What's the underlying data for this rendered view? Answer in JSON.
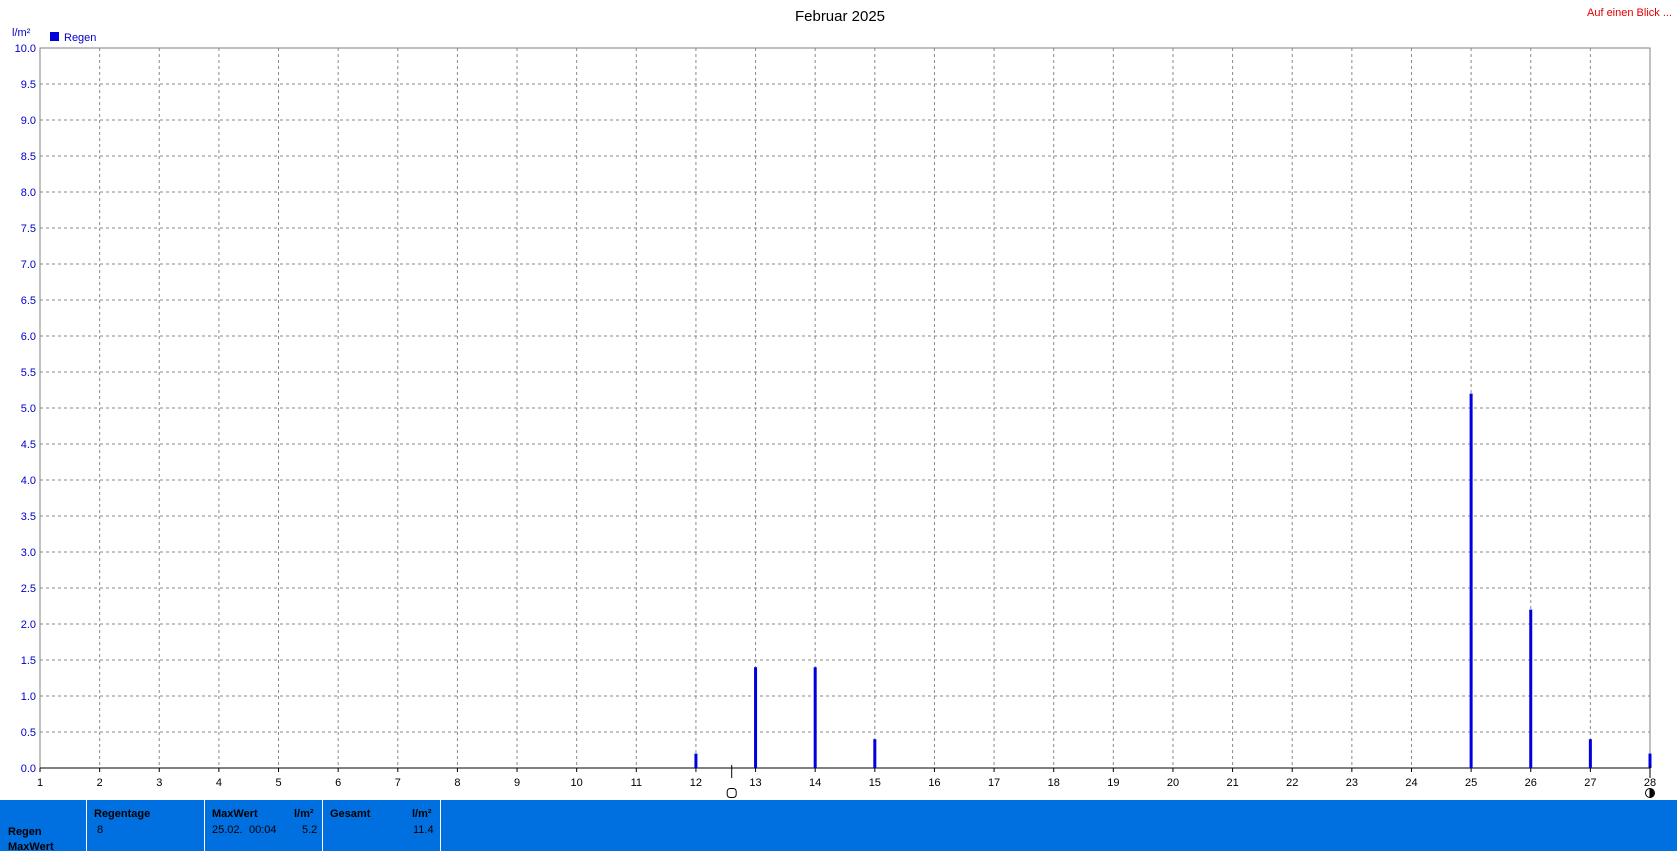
{
  "link": {
    "label": "Auf einen Blick ..."
  },
  "stats": {
    "row_labels": [
      "Regen",
      "MaxWert"
    ],
    "regentage": {
      "header": "Regentage",
      "value": "8"
    },
    "maxwert": {
      "header": "MaxWert",
      "unit": "l/m²",
      "date": "25.02.",
      "time": "00:04",
      "value": "5.2"
    },
    "gesamt": {
      "header": "Gesamt",
      "unit": "l/m²",
      "value": "11.4"
    }
  },
  "colors": {
    "series": "#0000dd",
    "stats_bg": "#0070e0",
    "link": "#e00000"
  },
  "chart_data": {
    "type": "bar",
    "title": "Februar 2025",
    "ylabel": "l/m²",
    "ylim": [
      0,
      10
    ],
    "yticks": [
      "0.0",
      "0.5",
      "1.0",
      "1.5",
      "2.0",
      "2.5",
      "3.0",
      "3.5",
      "4.0",
      "4.5",
      "5.0",
      "5.5",
      "6.0",
      "6.5",
      "7.0",
      "7.5",
      "8.0",
      "8.5",
      "9.0",
      "9.5",
      "10.0"
    ],
    "xlim": [
      1,
      28
    ],
    "xticks": [
      "1",
      "2",
      "3",
      "4",
      "5",
      "6",
      "7",
      "8",
      "9",
      "10",
      "11",
      "12",
      "13",
      "14",
      "15",
      "16",
      "17",
      "18",
      "19",
      "20",
      "21",
      "22",
      "23",
      "24",
      "25",
      "26",
      "27",
      "28"
    ],
    "grid": true,
    "legend_position": "top-left",
    "series": [
      {
        "name": "Regen",
        "x": [
          12,
          13,
          14,
          15,
          25,
          26,
          27,
          28
        ],
        "values": [
          0.2,
          1.4,
          1.4,
          0.4,
          5.2,
          2.2,
          0.4,
          0.2
        ]
      }
    ],
    "markers": [
      {
        "x": 12.6,
        "symbol": "new-moon-icon"
      },
      {
        "x": 28,
        "symbol": "full-moon-icon"
      }
    ]
  }
}
